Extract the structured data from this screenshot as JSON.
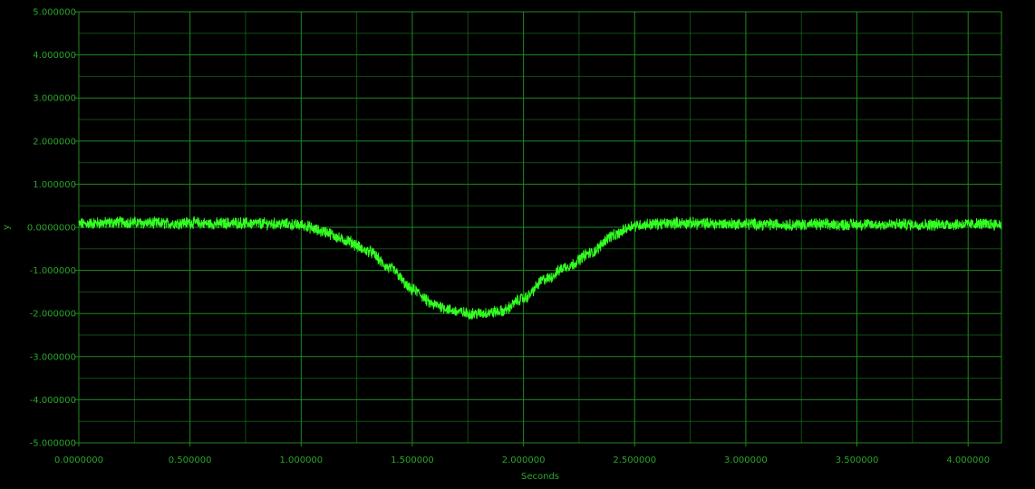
{
  "chart_data": {
    "type": "line",
    "title": "",
    "xlabel": "Seconds",
    "ylabel": "y",
    "xlim": [
      0,
      4.15
    ],
    "ylim": [
      -5,
      5
    ],
    "x_ticks": [
      0,
      0.5,
      1,
      1.5,
      2,
      2.5,
      3,
      3.5,
      4
    ],
    "x_tick_labels": [
      "0.0000000",
      "0.500000",
      "1.000000",
      "1.500000",
      "2.000000",
      "2.500000",
      "3.000000",
      "3.500000",
      "4.000000"
    ],
    "y_ticks": [
      5,
      4,
      3,
      2,
      1,
      0,
      -1,
      -2,
      -3,
      -4,
      -5
    ],
    "y_tick_labels": [
      "5.000000",
      "4.000000",
      "3.000000",
      "2.000000",
      "1.000000",
      "0.0000000",
      "-1.000000",
      "-2.000000",
      "-3.000000",
      "-4.000000",
      "-5.000000"
    ],
    "grid": true,
    "series": [
      {
        "x": [
          0,
          0.1,
          0.2,
          0.3,
          0.4,
          0.5,
          0.6,
          0.7,
          0.8,
          0.9,
          1.0,
          1.1,
          1.2,
          1.3,
          1.4,
          1.5,
          1.6,
          1.7,
          1.75,
          1.8,
          1.9,
          2.0,
          2.1,
          2.2,
          2.3,
          2.4,
          2.5,
          2.6,
          2.7,
          2.8,
          2.9,
          3.0,
          3.1,
          3.2,
          3.3,
          3.4,
          3.5,
          3.6,
          3.7,
          3.8,
          3.9,
          4.0,
          4.1,
          4.15
        ],
        "values": [
          0.08,
          0.1,
          0.12,
          0.1,
          0.09,
          0.11,
          0.08,
          0.1,
          0.09,
          0.08,
          0.05,
          -0.1,
          -0.3,
          -0.55,
          -0.95,
          -1.45,
          -1.8,
          -1.95,
          -2.0,
          -2.0,
          -1.95,
          -1.65,
          -1.2,
          -0.9,
          -0.6,
          -0.2,
          0.05,
          0.08,
          0.1,
          0.09,
          0.08,
          0.08,
          0.07,
          0.06,
          0.07,
          0.06,
          0.07,
          0.06,
          0.07,
          0.06,
          0.07,
          0.07,
          0.08,
          0.06
        ]
      }
    ],
    "colors": {
      "background": "#000000",
      "grid": "#1e8a1e",
      "text": "#2aa52a",
      "series": "#33ff22"
    }
  }
}
